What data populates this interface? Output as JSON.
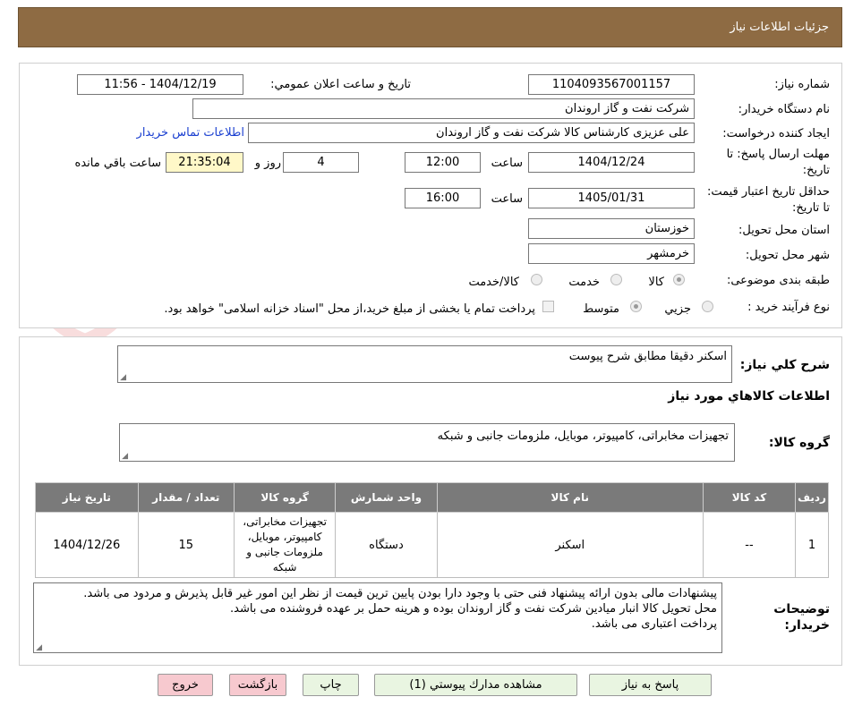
{
  "header": {
    "title": "جزئیات اطلاعات نیاز"
  },
  "watermark": "AriaTender.net",
  "form": {
    "need_number_label": "شماره نیاز:",
    "need_number": "1104093567001157",
    "announce_label": "تاریخ و ساعت اعلان عمومي:",
    "announce_value": "1404/12/19 - 11:56",
    "buyer_org_label": "نام دستگاه خریدار:",
    "buyer_org": "شرکت نفت و گاز اروندان",
    "requester_label": "ایجاد کننده درخواست:",
    "requester": "علی عزیزی کارشناس کالا شرکت نفت و گاز اروندان",
    "contact_link": "اطلاعات تماس خریدار",
    "deadline_label": "مهلت ارسال پاسخ: تا تاریخ:",
    "deadline_date": "1404/12/24",
    "time_label": "ساعت",
    "deadline_time": "12:00",
    "days": "4",
    "days_label": "روز و",
    "remaining": "21:35:04",
    "remaining_label": "ساعت باقي مانده",
    "validity_label": "حداقل تاریخ اعتبار قیمت: تا تاریخ:",
    "validity_date": "1405/01/31",
    "validity_time": "16:00",
    "province_label": "استان محل تحویل:",
    "province": "خوزستان",
    "city_label": "شهر محل تحویل:",
    "city": "خرمشهر",
    "category_label": "طبقه بندی موضوعی:",
    "category_options": [
      "کالا",
      "خدمت",
      "کالا/خدمت"
    ],
    "category_selected": "کالا",
    "process_label": "نوع فرآیند خرید :",
    "process_options": [
      "جزیي",
      "متوسط"
    ],
    "process_selected": "متوسط",
    "payment_note": "پرداخت تمام یا بخشی از مبلغ خرید،از محل \"اسناد خزانه اسلامی\" خواهد بود."
  },
  "summary": {
    "label": "شرح کلي نیاز:",
    "value": "اسکنر دقیقا مطابق شرح پیوست",
    "items_title": "اطلاعات کالاهاي مورد نیاز",
    "group_label": "گروه کالا:",
    "group_value": "تجهیزات مخابراتی، کامپیوتر، موبایل، ملزومات جانبی و شبکه"
  },
  "table": {
    "headers": [
      "ردیف",
      "کد کالا",
      "نام کالا",
      "واحد شمارش",
      "گروه کالا",
      "تعداد / مقدار",
      "تاریخ نیاز"
    ],
    "rows": [
      [
        "1",
        "--",
        "اسکنر",
        "دستگاه",
        "تجهیزات مخابراتی، کامپیوتر، موبایل، ملزومات جانبی و شبکه",
        "15",
        "1404/12/26"
      ]
    ]
  },
  "notes": {
    "label": "توضیحات خریدار:",
    "lines": [
      "پیشنهادات مالی بدون ارائه پیشنهاد فنی حتی با وجود دارا بودن پایین ترین قیمت از نظر این امور غیر قابل پذیرش و مردود می باشد.",
      "محل تحویل کالا انبار میادین شرکت نفت و گاز اروندان بوده و هرینه حمل بر عهده فروشنده می باشد.",
      "پرداخت اعتباری می باشد."
    ]
  },
  "buttons": {
    "reply": "پاسخ به نیاز",
    "attachments": "مشاهده مدارك پیوستي (1)",
    "print": "چاپ",
    "back": "بازگشت",
    "exit": "خروج"
  }
}
